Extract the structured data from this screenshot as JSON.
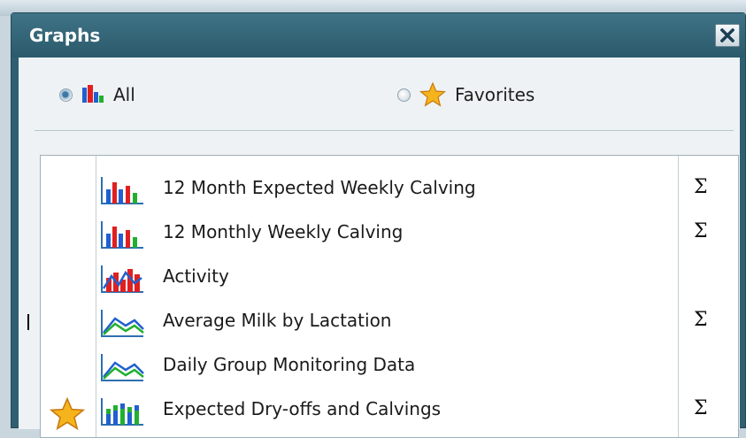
{
  "window": {
    "title": "Graphs",
    "close_icon": "close-icon"
  },
  "filter": {
    "options": [
      {
        "label": "All",
        "icon": "bar-chart-icon",
        "selected": true
      },
      {
        "label": "Favorites",
        "icon": "star-icon",
        "selected": false
      }
    ]
  },
  "graphs": [
    {
      "label": "12 Month Expected Weekly Calving",
      "icon": "bar-chart-icon",
      "sigma": "Σ",
      "favorite": false
    },
    {
      "label": "12 Monthly Weekly Calving",
      "icon": "bar-chart-icon",
      "sigma": "Σ",
      "favorite": false
    },
    {
      "label": "Activity",
      "icon": "bar-line-chart-icon",
      "sigma": "",
      "favorite": false
    },
    {
      "label": "Average Milk by Lactation",
      "icon": "line-chart-icon",
      "sigma": "Σ",
      "favorite": false
    },
    {
      "label": "Daily Group Monitoring Data",
      "icon": "line-chart-icon",
      "sigma": "",
      "favorite": false
    },
    {
      "label": "Expected Dry-offs and Calvings",
      "icon": "stacked-bar-chart-icon",
      "sigma": "Σ",
      "favorite": true
    }
  ],
  "colors": {
    "title_bar": "#2f5f70",
    "content_bg": "#eef2f4",
    "bar_red": "#e02020",
    "bar_blue": "#2060d0",
    "bar_green": "#20b030",
    "star": "#f6b41c"
  }
}
